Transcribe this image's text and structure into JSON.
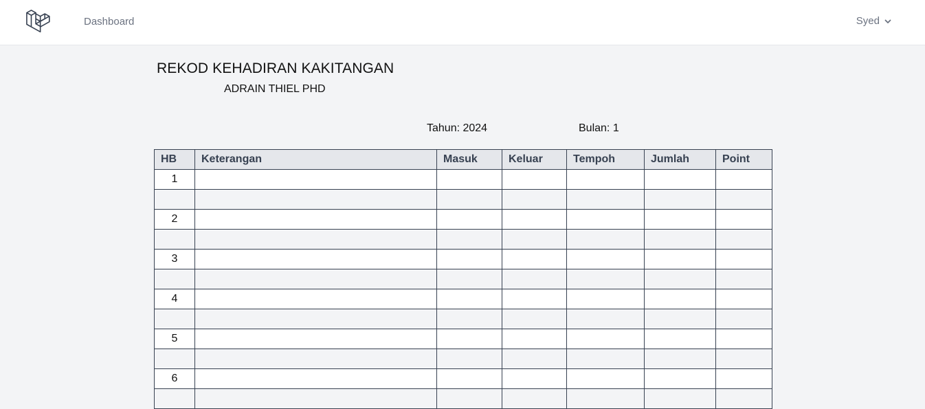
{
  "nav": {
    "dashboard_label": "Dashboard",
    "user_name": "Syed"
  },
  "report": {
    "title": "REKOD KEHADIRAN KAKITANGAN",
    "staff_name": "ADRAIN THIEL PHD",
    "year_text": "Tahun: 2024",
    "month_text": "Bulan: 1"
  },
  "table": {
    "headers": [
      "HB",
      "Keterangan",
      "Masuk",
      "Keluar",
      "Tempoh",
      "Jumlah",
      "Point"
    ],
    "days": [
      "1",
      "2",
      "3",
      "4",
      "5",
      "6"
    ]
  },
  "colors": {
    "nav_bg": "#ffffff",
    "page_bg": "#f3f4f6",
    "table_header_bg": "#e5e7eb",
    "border": "#374151"
  }
}
